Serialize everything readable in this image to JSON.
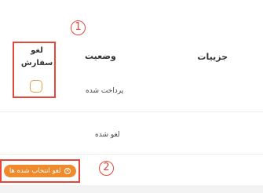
{
  "table": {
    "headers": {
      "details": "جزییات",
      "status": "وضعیت",
      "cancel_order_line1": "لغو",
      "cancel_order_line2": "سفارش"
    },
    "rows": [
      {
        "status": "پرداخت شده"
      },
      {
        "status": "لغو شده"
      }
    ]
  },
  "annotations": {
    "marker_1": "1",
    "marker_2": "2",
    "color": "#e4483a"
  },
  "actions": {
    "cancel_selected_label": "لغو انتخاب شده ها",
    "cancel_selected_icon": "x-circle-icon",
    "button_color": "#ef8b2c"
  }
}
